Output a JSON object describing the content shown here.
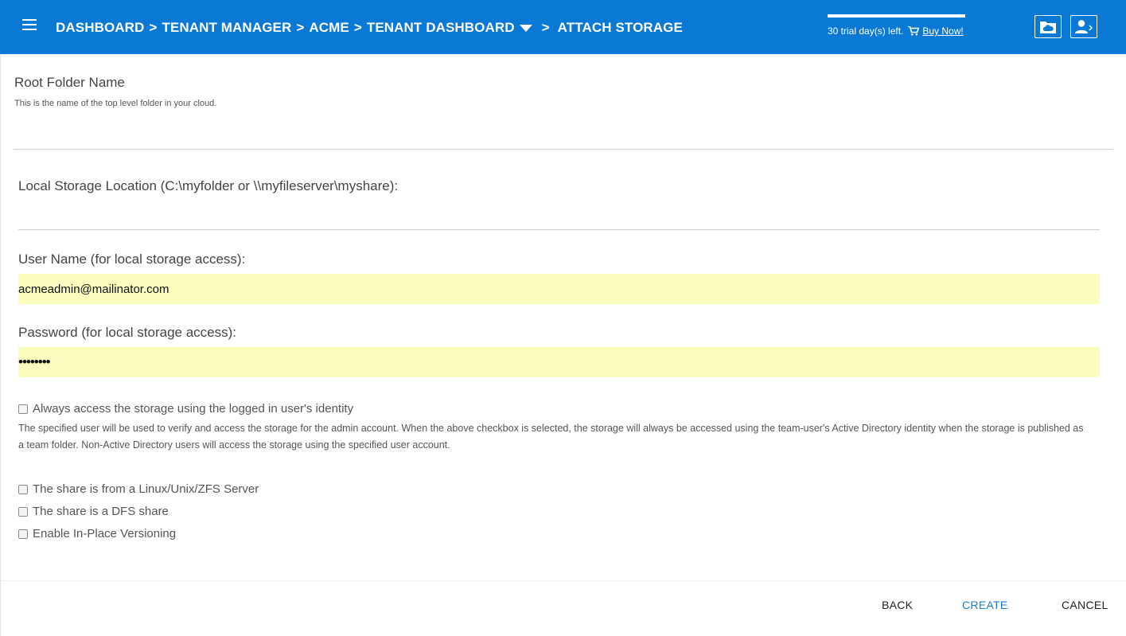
{
  "header": {
    "breadcrumb": {
      "items": [
        "DASHBOARD",
        "TENANT MANAGER",
        "ACME",
        "TENANT DASHBOARD"
      ],
      "separator": ">",
      "current": "ATTACH STORAGE"
    },
    "trial_text": "30 trial day(s) left.",
    "buy_label": "Buy Now!",
    "icons": [
      "cloud-folder-icon",
      "user-logout-icon"
    ]
  },
  "form": {
    "root_folder": {
      "label": "Root Folder Name",
      "help": "This is the name of the top level folder in your cloud.",
      "value": ""
    },
    "local_storage": {
      "label": "Local Storage Location (C:\\myfolder or \\\\myfileserver\\myshare):",
      "value": ""
    },
    "username": {
      "label": "User Name (for local storage access):",
      "value": "acmeadmin@mailinator.com"
    },
    "password": {
      "label": "Password (for local storage access):",
      "value": "••••••••"
    },
    "identity_checkbox": {
      "label": "Always access the storage using the logged in user's identity",
      "checked": false
    },
    "note": "The specified user will be used to verify and access the storage for the admin account. When the above checkbox is selected, the storage will always be accessed using the team-user's Active Directory identity when the storage is published as a team folder. Non-Active Directory users will access the storage using the specified user account.",
    "options": [
      {
        "label": "The share is from a Linux/Unix/ZFS Server",
        "checked": false
      },
      {
        "label": "The share is a DFS share",
        "checked": false
      },
      {
        "label": "Enable In-Place Versioning",
        "checked": false
      }
    ]
  },
  "footer": {
    "back_label": "BACK",
    "create_label": "CREATE",
    "cancel_label": "CANCEL"
  },
  "colors": {
    "header_bg": "#0a79d6",
    "accent": "#1a7fd0",
    "autofill": "#fafdbd"
  }
}
